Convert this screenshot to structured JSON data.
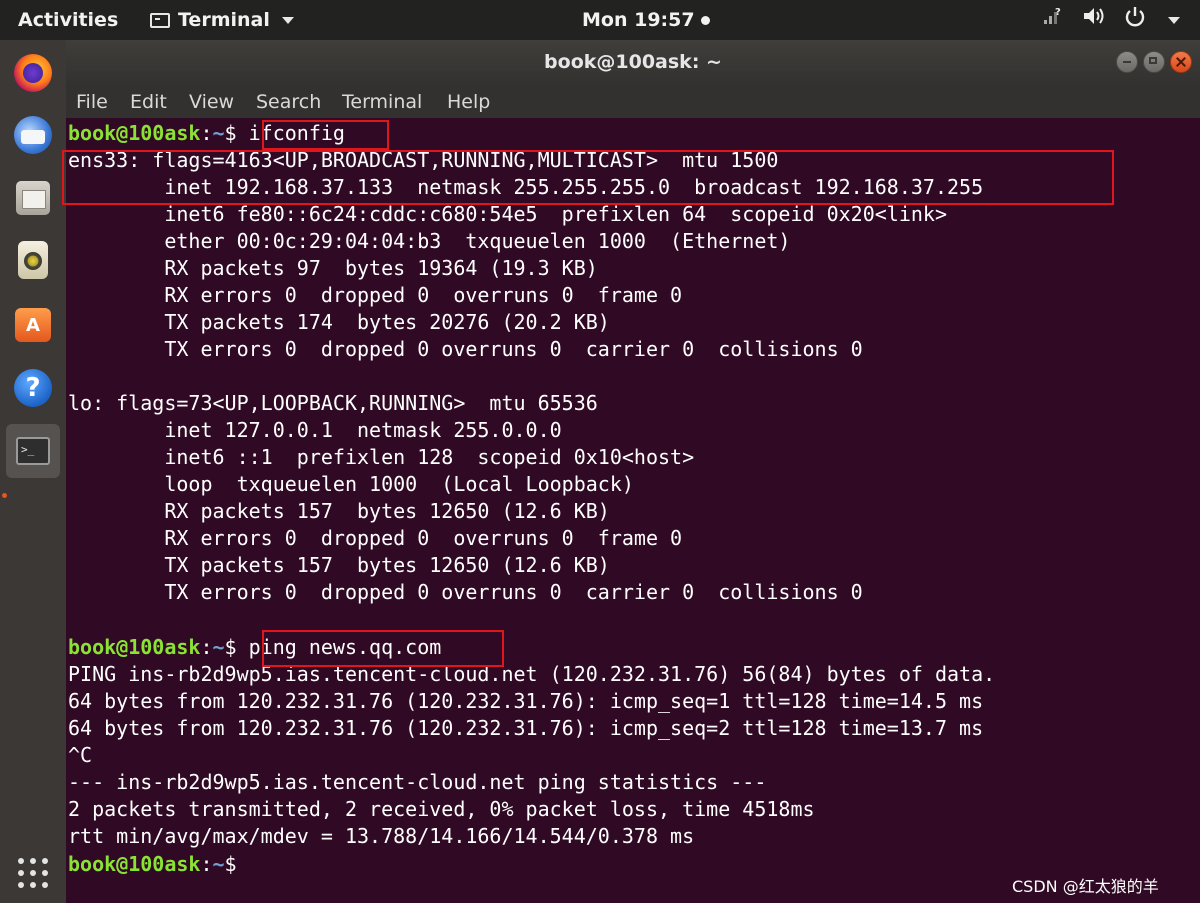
{
  "top_panel": {
    "activities": "Activities",
    "app_menu": "Terminal",
    "clock": "Mon 19:57",
    "status_icons": [
      "network-icon",
      "volume-icon",
      "power-icon"
    ]
  },
  "dock": {
    "items": [
      "Firefox",
      "Thunderbird",
      "Files",
      "Rhythmbox",
      "Ubuntu Software",
      "Help",
      "Terminal"
    ],
    "software_glyph": "A",
    "help_glyph": "?",
    "terminal_glyph": ">_"
  },
  "window": {
    "title": "book@100ask: ~",
    "menu": [
      "File",
      "Edit",
      "View",
      "Search",
      "Terminal",
      "Help"
    ]
  },
  "terminal": {
    "prompt_user": "book@100ask",
    "prompt_sep": ":",
    "prompt_path": "~",
    "prompt_end": "$ ",
    "commands": [
      "ifconfig",
      "ping news.qq.com"
    ],
    "ifconfig_output": [
      "ens33: flags=4163<UP,BROADCAST,RUNNING,MULTICAST>  mtu 1500",
      "        inet 192.168.37.133  netmask 255.255.255.0  broadcast 192.168.37.255",
      "        inet6 fe80::6c24:cddc:c680:54e5  prefixlen 64  scopeid 0x20<link>",
      "        ether 00:0c:29:04:04:b3  txqueuelen 1000  (Ethernet)",
      "        RX packets 97  bytes 19364 (19.3 KB)",
      "        RX errors 0  dropped 0  overruns 0  frame 0",
      "        TX packets 174  bytes 20276 (20.2 KB)",
      "        TX errors 0  dropped 0 overruns 0  carrier 0  collisions 0",
      "",
      "lo: flags=73<UP,LOOPBACK,RUNNING>  mtu 65536",
      "        inet 127.0.0.1  netmask 255.0.0.0",
      "        inet6 ::1  prefixlen 128  scopeid 0x10<host>",
      "        loop  txqueuelen 1000  (Local Loopback)",
      "        RX packets 157  bytes 12650 (12.6 KB)",
      "        RX errors 0  dropped 0  overruns 0  frame 0",
      "        TX packets 157  bytes 12650 (12.6 KB)",
      "        TX errors 0  dropped 0 overruns 0  carrier 0  collisions 0",
      ""
    ],
    "ping_output": [
      "PING ins-rb2d9wp5.ias.tencent-cloud.net (120.232.31.76) 56(84) bytes of data.",
      "64 bytes from 120.232.31.76 (120.232.31.76): icmp_seq=1 ttl=128 time=14.5 ms",
      "64 bytes from 120.232.31.76 (120.232.31.76): icmp_seq=2 ttl=128 time=13.7 ms",
      "^C",
      "--- ins-rb2d9wp5.ias.tencent-cloud.net ping statistics ---",
      "2 packets transmitted, 2 received, 0% packet loss, time 4518ms",
      "rtt min/avg/max/mdev = 13.788/14.166/14.544/0.378 ms"
    ]
  },
  "watermark": "CSDN @红太狼的羊",
  "colors": {
    "terminal_bg": "#300a24",
    "prompt_user": "#8ae234",
    "prompt_path": "#729fcf",
    "highlight_box": "#e0161d"
  }
}
